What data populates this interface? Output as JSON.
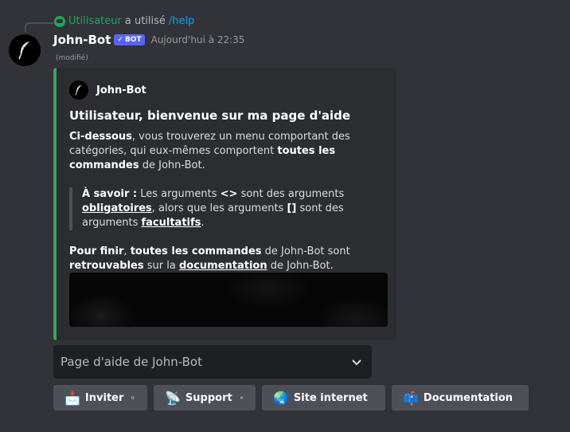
{
  "reply": {
    "user": "Utilisateur",
    "action": "a utilisé",
    "command": "/help"
  },
  "message": {
    "author": "John-Bot",
    "bot_tag": "BOT",
    "bot_check": "✓",
    "timestamp": "Aujourd'hui à 22:35",
    "edited": "(modifié)"
  },
  "embed": {
    "color": "#3ba55c",
    "author_name": "John-Bot",
    "title": "Utilisateur, bienvenue sur ma page d'aide",
    "p1_b1": "Ci-dessous",
    "p1_t1": ", vous trouverez un menu comportant des catégories, qui eux-mêmes comportent ",
    "p1_b2": "toutes les commandes",
    "p1_t2": " de John-Bot.",
    "q_b1": "À savoir :",
    "q_t1": " Les arguments ",
    "q_b2": "<>",
    "q_t2": " sont des arguments ",
    "q_u1": "obligatoires",
    "q_t3": ", alors que les arguments ",
    "q_b3": "[]",
    "q_t4": " sont des arguments ",
    "q_u2": "facultatifs",
    "q_t5": ".",
    "p2_b1": "Pour finir",
    "p2_t1": ", ",
    "p2_b2": "toutes les commandes",
    "p2_t2": " de John-Bot sont ",
    "p2_b3": "retrouvables",
    "p2_t3": " sur la ",
    "p2_u1": "documentation",
    "p2_t4": " de John-Bot."
  },
  "select": {
    "placeholder": "Page d'aide de John-Bot"
  },
  "buttons": [
    {
      "label": "Inviter",
      "emoji": "📩",
      "icon": "incoming-envelope-icon"
    },
    {
      "label": "Support",
      "emoji": "📡",
      "icon": "satellite-antenna-icon"
    },
    {
      "label": "Site internet",
      "emoji": "🌏",
      "icon": "globe-icon"
    },
    {
      "label": "Documentation",
      "emoji": "📫",
      "icon": "mailbox-icon"
    }
  ]
}
